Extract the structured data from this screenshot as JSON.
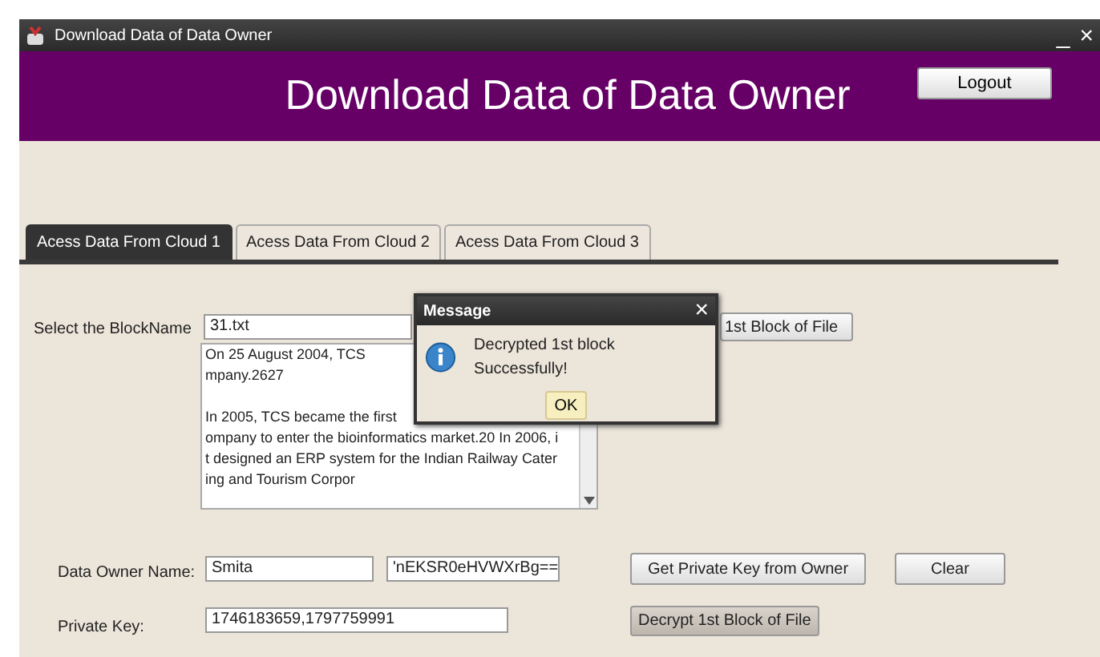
{
  "window": {
    "title": "Download Data of Data Owner",
    "controls": [
      "_",
      "×"
    ]
  },
  "header": {
    "title": "Download Data of Data Owner",
    "logout": "Logout"
  },
  "tabs": [
    {
      "label": "Acess Data From Cloud 1",
      "selected": true
    },
    {
      "label": "Acess Data From Cloud 2",
      "selected": false
    },
    {
      "label": "Acess Data From Cloud 3",
      "selected": false
    }
  ],
  "block": {
    "label": "Select the BlockName",
    "value": "31.txt",
    "button": "1st Block of File"
  },
  "content_paragraphs": [
    [
      "On 25 August 2004, TCS",
      "mpany.2627"
    ],
    [
      "In 2005, TCS became the first",
      "ompany to enter the bioinformatics market.20 In 2006, i",
      "t designed an ERP system for the Indian Railway Cater",
      "ing and Tourism Corpor"
    ]
  ],
  "owner": {
    "label": "Data Owner Name:",
    "name": "Smita",
    "code": "'nEKSR0eHVWXrBg==",
    "get_key": "Get Private Key from Owner",
    "clear": "Clear"
  },
  "key": {
    "label": "Private Key:",
    "value": "1746183659,1797759991",
    "decrypt": "Decrypt 1st Block of File"
  },
  "dialog": {
    "title": "Message",
    "close": "×",
    "message": "Decrypted 1st block Successfully!",
    "ok": "OK"
  }
}
